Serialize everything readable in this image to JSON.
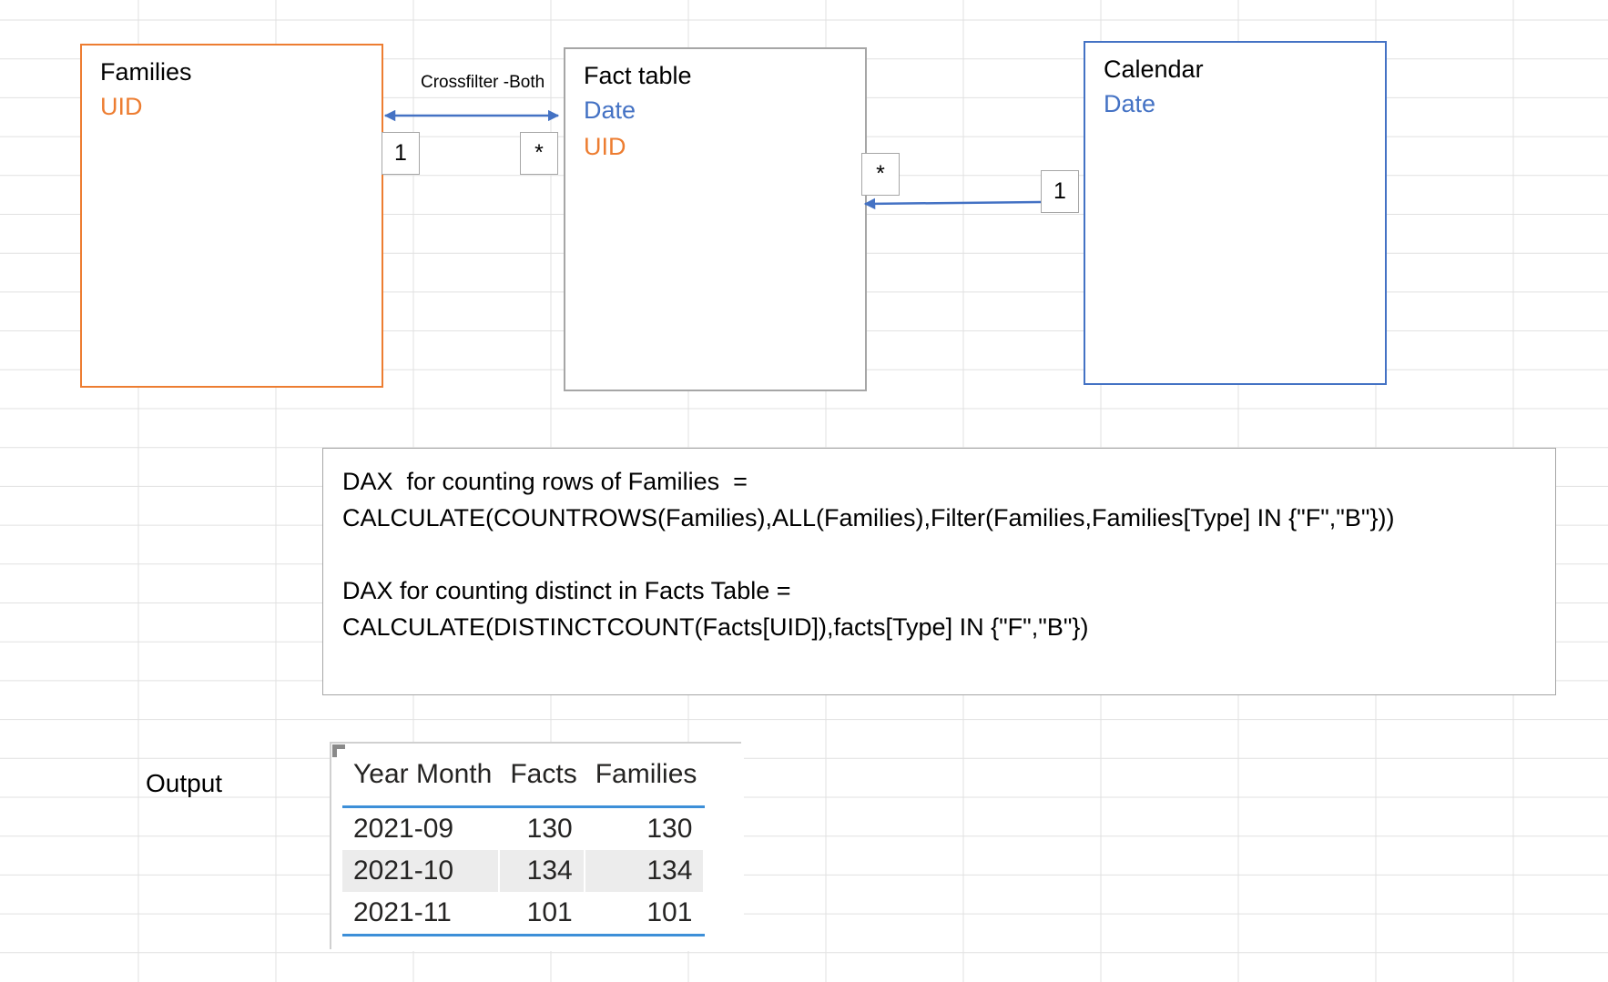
{
  "tables": {
    "families": {
      "title": "Families",
      "fields": [
        "UID"
      ]
    },
    "fact": {
      "title": "Fact table",
      "fields": [
        "Date",
        "UID"
      ]
    },
    "calendar": {
      "title": "Calendar",
      "fields": [
        "Date"
      ]
    }
  },
  "relationships": [
    {
      "from": "Families",
      "to": "Fact table",
      "from_card": "1",
      "to_card": "*",
      "label": "Crossfilter -Both"
    },
    {
      "from": "Calendar",
      "to": "Fact table",
      "from_card": "1",
      "to_card": "*"
    }
  ],
  "dax": {
    "line1": "DAX  for counting rows of Families  =",
    "line2": "CALCULATE(COUNTROWS(Families),ALL(Families),Filter(Families,Families[Type] IN {\"F\",\"B\"}))",
    "line3": "DAX for counting distinct in Facts Table =",
    "line4": "CALCULATE(DISTINCTCOUNT(Facts[UID]),facts[Type] IN {\"F\",\"B\"})"
  },
  "output": {
    "label": "Output",
    "columns": [
      "Year Month",
      "Facts",
      "Families"
    ],
    "rows": [
      [
        "2021-09",
        "130",
        "130"
      ],
      [
        "2021-10",
        "134",
        "134"
      ],
      [
        "2021-11",
        "101",
        "101"
      ]
    ]
  },
  "colors": {
    "families_border": "#ed7d31",
    "calendar_border": "#4472c4",
    "fact_border": "#a6a6a6",
    "arrow": "#4472c4",
    "table_accent": "#3d8fd8"
  }
}
